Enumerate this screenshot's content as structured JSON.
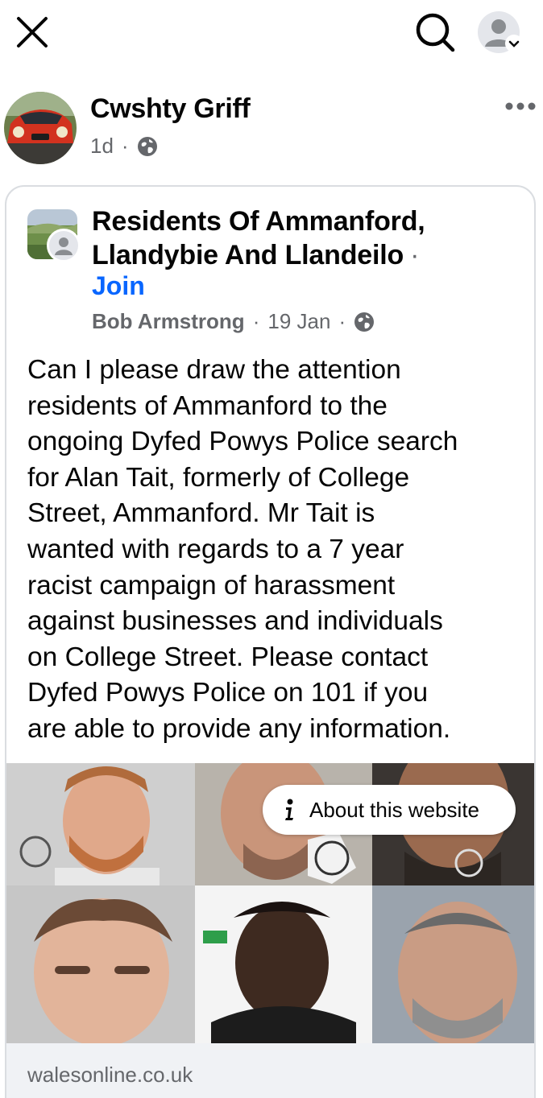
{
  "topbar": {
    "close_icon": "close-icon",
    "search_icon": "search-icon",
    "profile_icon": "profile-menu-icon"
  },
  "post": {
    "author": "Cwshty Griff",
    "time": "1d",
    "separator": "·",
    "privacy_icon": "globe-icon",
    "more_icon": "more-horizontal-icon"
  },
  "shared_post": {
    "group_name": "Residents Of Ammanford, Llandybie And Llandeilo",
    "group_separator": "·",
    "join_label": "Join",
    "author": "Bob Armstrong",
    "date": "19 Jan",
    "separator": "·",
    "privacy_icon": "globe-icon",
    "text": "Can I please draw the attention\nresidents of Ammanford to the\nongoing Dyfed Powys Police search\nfor Alan Tait, formerly of College\nStreet, Ammanford. Mr Tait is\nwanted with regards to a 7 year\nracist campaign of harassment\nagainst businesses and individuals\non College Street. Please contact\nDyfed Powys Police on 101 if you\nare able to provide any information."
  },
  "link_preview": {
    "about_label": "About this website",
    "domain": "walesonline.co.uk"
  },
  "colors": {
    "link_blue": "#0866ff",
    "meta_gray": "#65676b",
    "card_border": "#dadde1",
    "preview_bg": "#f0f2f5"
  }
}
